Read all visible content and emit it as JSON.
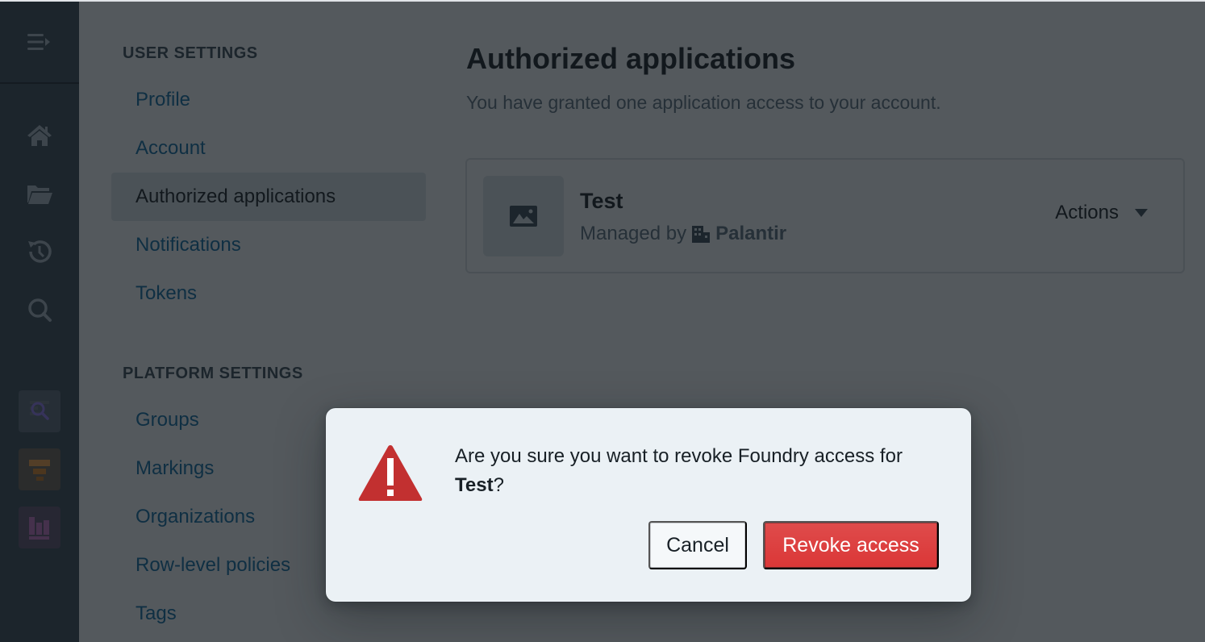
{
  "rail": {
    "icons": [
      "menu-expand-icon",
      "home-icon",
      "folder-open-icon",
      "history-icon",
      "search-icon"
    ],
    "apps": [
      {
        "name": "object-explorer-app-icon",
        "bg": "#5a6978",
        "fg": "#9179f2"
      },
      {
        "name": "funnel-app-icon",
        "bg": "#6b6359",
        "fg": "#f29d49"
      },
      {
        "name": "analytics-app-icon",
        "bg": "#5e5270",
        "fg": "#c274c2"
      }
    ]
  },
  "settings_nav": {
    "user_heading": "USER SETTINGS",
    "user_items": [
      {
        "label": "Profile",
        "active": false
      },
      {
        "label": "Account",
        "active": false
      },
      {
        "label": "Authorized applications",
        "active": true
      },
      {
        "label": "Notifications",
        "active": false
      },
      {
        "label": "Tokens",
        "active": false
      }
    ],
    "platform_heading": "PLATFORM SETTINGS",
    "platform_items": [
      {
        "label": "Groups"
      },
      {
        "label": "Markings"
      },
      {
        "label": "Organizations"
      },
      {
        "label": "Row-level policies"
      },
      {
        "label": "Tags"
      }
    ]
  },
  "main": {
    "title": "Authorized applications",
    "subtitle": "You have granted one application access to your account.",
    "applications": [
      {
        "name": "Test",
        "managed_by_prefix": "Managed by",
        "organization": "Palantir",
        "actions_label": "Actions"
      }
    ]
  },
  "dialog": {
    "message_prefix": "Are you sure you want to revoke Foundry access for ",
    "app_name": "Test",
    "message_suffix": "?",
    "cancel_label": "Cancel",
    "confirm_label": "Revoke access",
    "colors": {
      "danger": "#db3737",
      "warning_icon": "#c23030"
    }
  }
}
